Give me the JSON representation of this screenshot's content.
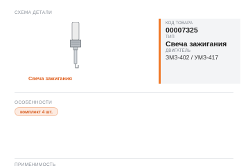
{
  "diagram": {
    "section_label": "СХЕМА ДЕТАЛИ",
    "caption": "Свеча зажигания",
    "icon": "spark-plug-icon"
  },
  "info": {
    "code_label": "КОД ТОВАРА",
    "code_value": "00007325",
    "type_label": "ТИП",
    "type_value": "Свеча зажигания",
    "engine_label": "ДВИГАТЕЛЬ",
    "engine_value": "ЗМЗ-402 / УМЗ-417"
  },
  "features": {
    "section_label": "ОСОБЕННОСТИ",
    "badge": "комплект 4 шт."
  },
  "applicability": {
    "section_label": "ПРИМЕНИМОСТЬ"
  },
  "colors": {
    "accent": "#f07a2a",
    "caption": "#e0601f",
    "panel_bg": "#f3f4f6"
  }
}
